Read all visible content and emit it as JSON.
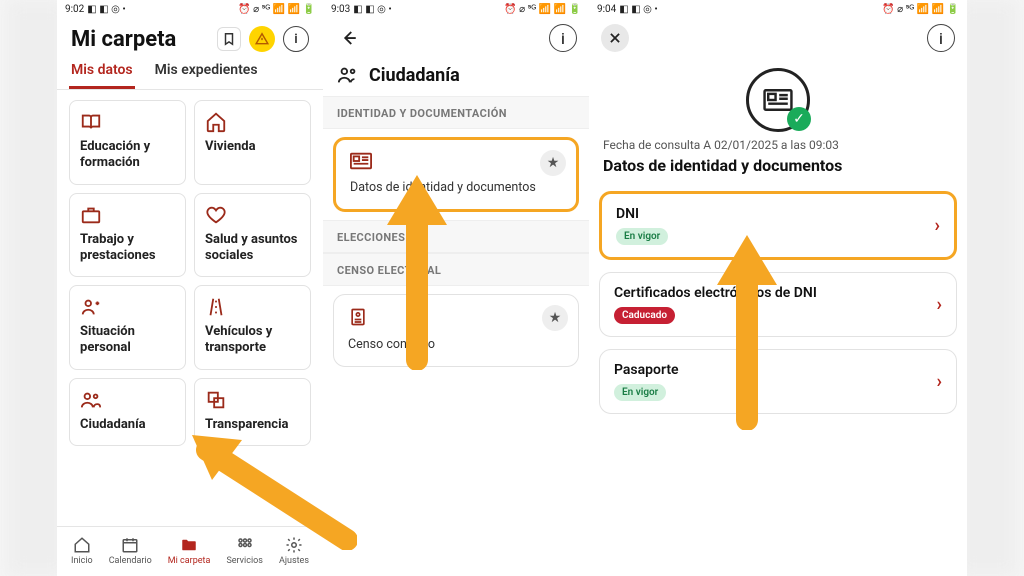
{
  "phone1": {
    "statusbar": {
      "time": "9:02"
    },
    "title": "Mi carpeta",
    "tabs": {
      "active": "Mis datos",
      "inactive": "Mis expedientes"
    },
    "cards": [
      {
        "label": "Educación y formación",
        "icon": "book-icon"
      },
      {
        "label": "Vivienda",
        "icon": "home-icon"
      },
      {
        "label": "Trabajo y prestaciones",
        "icon": "briefcase-icon"
      },
      {
        "label": "Salud y asuntos sociales",
        "icon": "heart-icon"
      },
      {
        "label": "Situación personal",
        "icon": "person-icon"
      },
      {
        "label": "Vehículos y transporte",
        "icon": "road-icon"
      },
      {
        "label": "Ciudadanía",
        "icon": "people-icon"
      },
      {
        "label": "Transparencia",
        "icon": "copy-icon"
      }
    ],
    "bottomnav": [
      {
        "label": "Inicio"
      },
      {
        "label": "Calendario"
      },
      {
        "label": "Mi carpeta"
      },
      {
        "label": "Servicios"
      },
      {
        "label": "Ajustes"
      }
    ]
  },
  "phone2": {
    "statusbar": {
      "time": "9:03"
    },
    "title": "Ciudadanía",
    "sections": {
      "s1": "IDENTIDAD Y DOCUMENTACIÓN",
      "s2": "ELECCIONES",
      "s3": "CENSO ELECTORAL"
    },
    "items": {
      "identidad": "Datos de identidad y documentos",
      "censo": "Censo continuo"
    }
  },
  "phone3": {
    "statusbar": {
      "time": "9:04"
    },
    "meta": "Fecha de consulta A 02/01/2025 a las 09:03",
    "title": "Datos de identidad y documentos",
    "rows": [
      {
        "title": "DNI",
        "chip": "En vigor",
        "chipClass": "green"
      },
      {
        "title": "Certificados electrónicos de DNI",
        "chip": "Caducado",
        "chipClass": "red"
      },
      {
        "title": "Pasaporte",
        "chip": "En vigor",
        "chipClass": "green"
      }
    ]
  }
}
